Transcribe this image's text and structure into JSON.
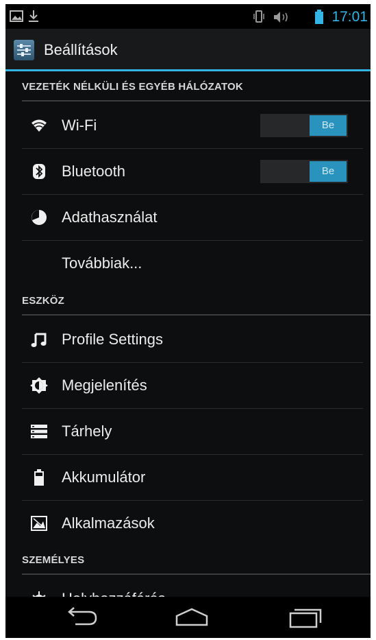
{
  "status_bar": {
    "icons": [
      "image-notification-icon",
      "download-icon",
      "vibrate-icon",
      "volume-icon",
      "battery-icon"
    ],
    "time": "17:01",
    "accent": "#33b5e5"
  },
  "action_bar": {
    "title": "Beállítások",
    "icon": "settings-app-icon"
  },
  "sections": [
    {
      "header": "VEZETÉK NÉLKÜLI ÉS EGYÉB HÁLÓZATOK",
      "items": [
        {
          "label": "Wi-Fi",
          "icon": "wifi-icon",
          "toggle": "Be"
        },
        {
          "label": "Bluetooth",
          "icon": "bluetooth-icon",
          "toggle": "Be"
        },
        {
          "label": "Adathasználat",
          "icon": "data-usage-icon"
        },
        {
          "label": "Továbbiak...",
          "icon": ""
        }
      ]
    },
    {
      "header": "ESZKÖZ",
      "items": [
        {
          "label": "Profile Settings",
          "icon": "music-note-icon"
        },
        {
          "label": "Megjelenítés",
          "icon": "brightness-icon"
        },
        {
          "label": "Tárhely",
          "icon": "storage-icon"
        },
        {
          "label": "Akkumulátor",
          "icon": "battery-icon"
        },
        {
          "label": "Alkalmazások",
          "icon": "apps-icon"
        }
      ]
    },
    {
      "header": "SZEMÉLYES",
      "items": [
        {
          "label": "Helyhozzáférés",
          "icon": "location-icon"
        }
      ]
    }
  ],
  "nav_bar": {
    "buttons": [
      "back-icon",
      "home-icon",
      "recent-apps-icon"
    ]
  }
}
